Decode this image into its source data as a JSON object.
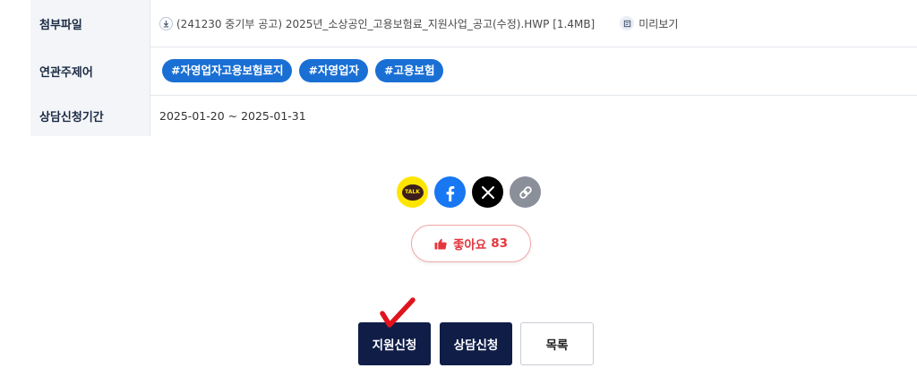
{
  "info": {
    "attachment_label": "첨부파일",
    "attachment_file": "(241230 중기부 공고) 2025년_소상공인_고용보험료_지원사업_공고(수정).HWP [1.4MB]",
    "preview_label": "미리보기",
    "related_label": "연관주제어",
    "tags": [
      "#자영업자고용보험료지",
      "#자영업자",
      "#고용보험"
    ],
    "period_label": "상담신청기간",
    "period_value": "2025-01-20 ~ 2025-01-31"
  },
  "share": {
    "kakao_text": "TALK",
    "icons": [
      "kakaotalk-icon",
      "facebook-icon",
      "x-icon",
      "link-icon"
    ]
  },
  "like": {
    "label": "좋아요",
    "count": "83"
  },
  "buttons": {
    "apply": "지원신청",
    "consult": "상담신청",
    "list": "목록"
  },
  "colors": {
    "tag_blue": "#1a6fd4",
    "navy": "#0f1d47",
    "like_red": "#e4373d",
    "check_red": "#e0141e"
  }
}
